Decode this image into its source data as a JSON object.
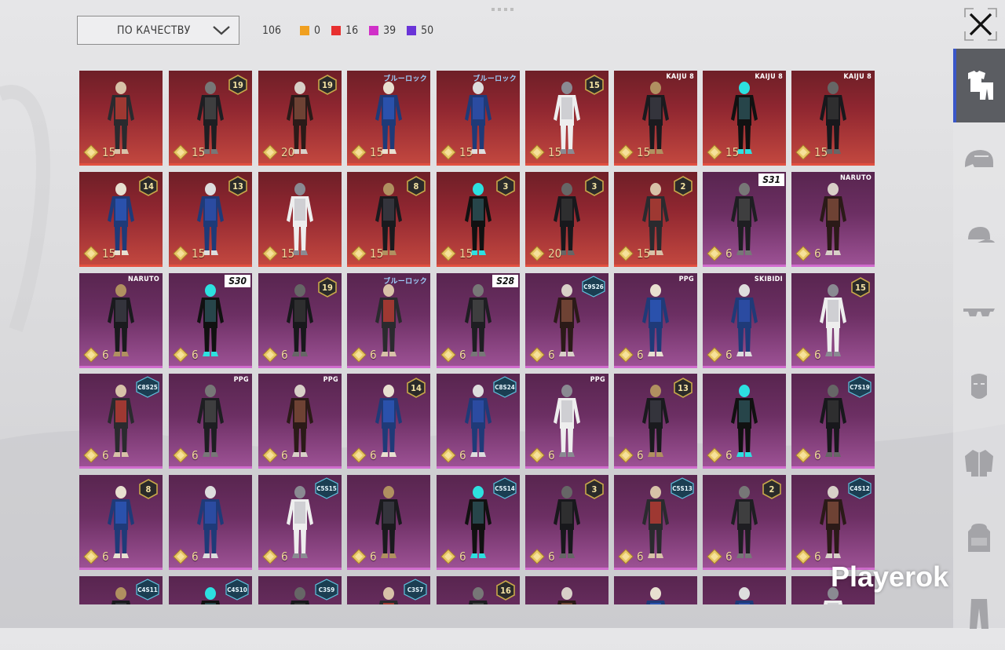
{
  "sort": {
    "label": "ПО КАЧЕСТВУ"
  },
  "stats": {
    "total": "106",
    "items": [
      {
        "value": "0",
        "color": "#f0a020"
      },
      {
        "value": "16",
        "color": "#e83030"
      },
      {
        "value": "39",
        "color": "#d030c8"
      },
      {
        "value": "50",
        "color": "#6a34d8"
      }
    ]
  },
  "watermark": "Playerok",
  "sidebar": {
    "items": [
      {
        "icon": "outfit-icon",
        "active": true
      },
      {
        "icon": "helmet-icon"
      },
      {
        "icon": "cap-icon"
      },
      {
        "icon": "glasses-icon"
      },
      {
        "icon": "mask-icon"
      },
      {
        "icon": "jacket-icon"
      },
      {
        "icon": "backpack-icon"
      },
      {
        "icon": "pants-icon"
      }
    ]
  },
  "colors": {
    "red": "#8f2630",
    "purple": "#6c2f63",
    "accent": "#3a56c8"
  },
  "rows": [
    [
      {
        "q": "red",
        "cost": "15",
        "badge": null
      },
      {
        "q": "red",
        "cost": "15",
        "badge": "19"
      },
      {
        "q": "red",
        "cost": "20",
        "badge": "19"
      },
      {
        "q": "red",
        "cost": "15",
        "collab": "ブルーロック"
      },
      {
        "q": "red",
        "cost": "15",
        "collab": "ブルーロック"
      },
      {
        "q": "red",
        "cost": "15",
        "badge": "15"
      },
      {
        "q": "red",
        "cost": "15",
        "collab": "KAIJU 8"
      },
      {
        "q": "red",
        "cost": "15",
        "collab": "KAIJU 8"
      },
      {
        "q": "red",
        "cost": "15",
        "collab": "KAIJU 8"
      }
    ],
    [
      {
        "q": "red",
        "cost": "15",
        "badge": "14"
      },
      {
        "q": "red",
        "cost": "15",
        "badge": "13"
      },
      {
        "q": "red",
        "cost": "15"
      },
      {
        "q": "red",
        "cost": "15",
        "badge": "8"
      },
      {
        "q": "red",
        "cost": "15",
        "badge": "3"
      },
      {
        "q": "red",
        "cost": "20",
        "badge": "3"
      },
      {
        "q": "red",
        "cost": "15",
        "badge": "2"
      },
      {
        "q": "purple",
        "cost": "6",
        "tag": "S31"
      },
      {
        "q": "purple",
        "cost": "6",
        "collab": "NARUTO"
      }
    ],
    [
      {
        "q": "purple",
        "cost": "6",
        "collab": "NARUTO"
      },
      {
        "q": "purple",
        "cost": "6",
        "tag": "S30"
      },
      {
        "q": "purple",
        "cost": "6",
        "badge": "19"
      },
      {
        "q": "purple",
        "cost": "6",
        "collab": "ブルーロック"
      },
      {
        "q": "purple",
        "cost": "6",
        "tag": "S28"
      },
      {
        "q": "purple",
        "cost": "6",
        "season": "C9S26"
      },
      {
        "q": "purple",
        "cost": "6",
        "collab": "PPG"
      },
      {
        "q": "purple",
        "cost": "6",
        "collab": "SKIBIDI"
      },
      {
        "q": "purple",
        "cost": "6",
        "badge": "15"
      }
    ],
    [
      {
        "q": "purple",
        "cost": "6",
        "season": "C8S25"
      },
      {
        "q": "purple",
        "cost": "6",
        "collab": "PPG"
      },
      {
        "q": "purple",
        "cost": "6",
        "collab": "PPG"
      },
      {
        "q": "purple",
        "cost": "6",
        "badge": "14"
      },
      {
        "q": "purple",
        "cost": "6",
        "season": "C8S24"
      },
      {
        "q": "purple",
        "cost": "6",
        "collab": "PPG"
      },
      {
        "q": "purple",
        "cost": "6",
        "badge": "13"
      },
      {
        "q": "purple",
        "cost": "6"
      },
      {
        "q": "purple",
        "cost": "6",
        "season": "C7S19"
      }
    ],
    [
      {
        "q": "purple",
        "cost": "6",
        "badge": "8"
      },
      {
        "q": "purple",
        "cost": "6"
      },
      {
        "q": "purple",
        "cost": "6",
        "season": "C5S15"
      },
      {
        "q": "purple",
        "cost": "6"
      },
      {
        "q": "purple",
        "cost": "6",
        "season": "C5S14"
      },
      {
        "q": "purple",
        "cost": "6",
        "badge": "3"
      },
      {
        "q": "purple",
        "cost": "6",
        "season": "C5S13"
      },
      {
        "q": "purple",
        "cost": "6",
        "badge": "2"
      },
      {
        "q": "purple",
        "cost": "6",
        "season": "C4S12"
      }
    ],
    [
      {
        "q": "purple",
        "season": "C4S11"
      },
      {
        "q": "purple",
        "season": "C4S10"
      },
      {
        "q": "purple",
        "season": "C3S9"
      },
      {
        "q": "purple",
        "season": "C3S7"
      },
      {
        "q": "purple",
        "badge": "16"
      },
      {
        "q": "purple"
      },
      {
        "q": "purple"
      },
      {
        "q": "purple"
      },
      {
        "q": "purple"
      }
    ]
  ]
}
